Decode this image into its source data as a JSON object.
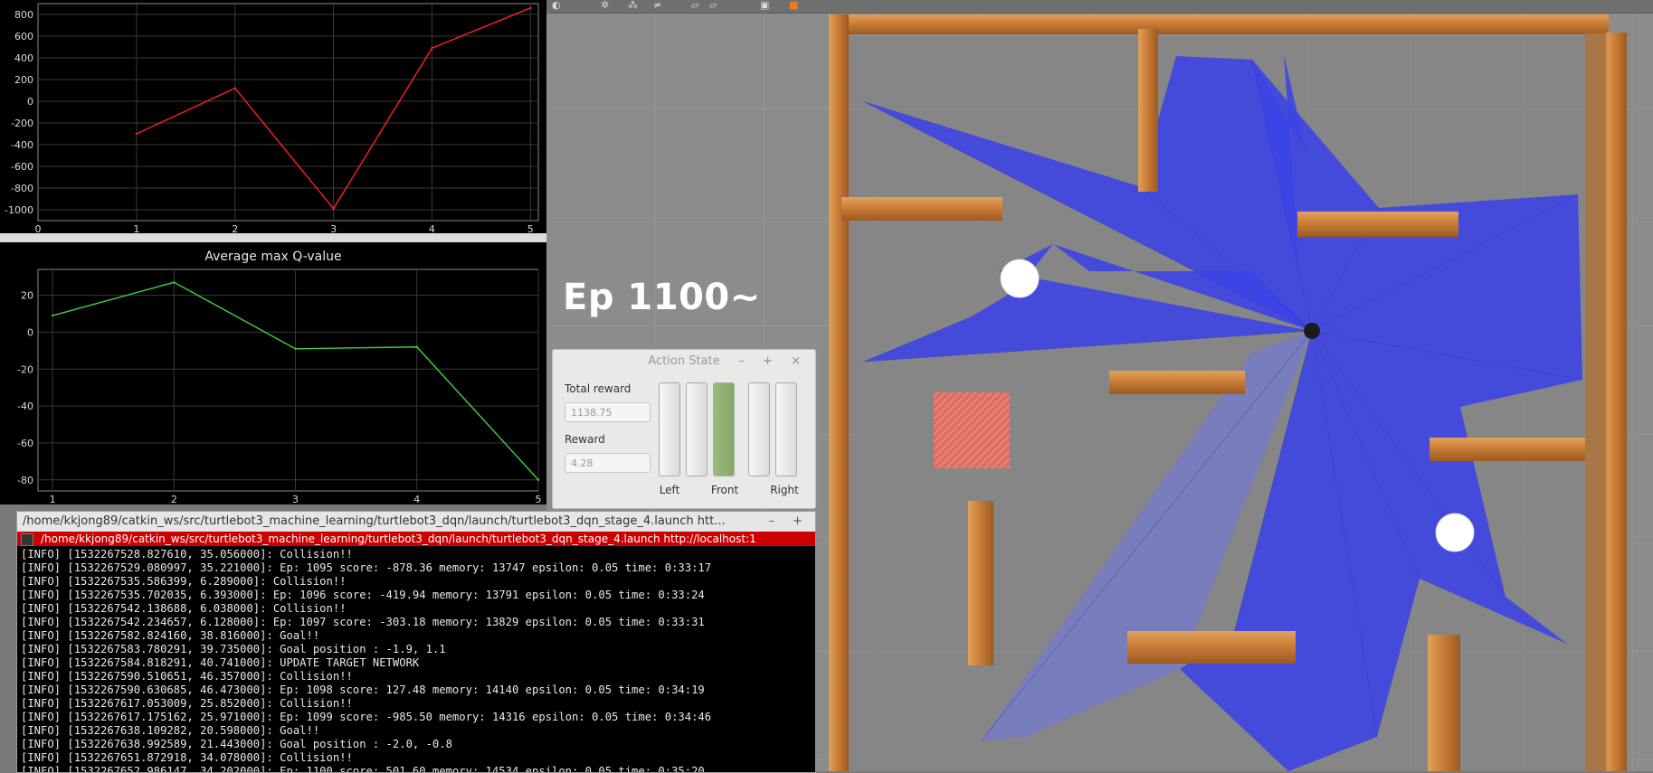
{
  "overlay": {
    "episode_label": "Ep 1100~"
  },
  "plot_score": {
    "chart_data": {
      "type": "line",
      "title": "",
      "x": [
        1,
        2,
        3,
        4,
        5
      ],
      "series": [
        {
          "values": [
            -300,
            120,
            -990,
            490,
            860
          ],
          "color": "#ff2020"
        }
      ],
      "y_ticks": [
        "800",
        "600",
        "400",
        "200",
        "0",
        "-200",
        "-400",
        "-600",
        "-800",
        "-1000"
      ],
      "x_ticks": [
        "0",
        "1",
        "2",
        "3",
        "4",
        "5"
      ],
      "ylim": [
        -1100,
        900
      ],
      "grid": true
    }
  },
  "plot_q": {
    "title": "Average max Q-value",
    "chart_data": {
      "type": "line",
      "title": "Average max Q-value",
      "x": [
        1,
        2,
        3,
        4,
        5
      ],
      "series": [
        {
          "values": [
            9,
            27,
            -9,
            -8,
            -80
          ],
          "color": "#40d040"
        }
      ],
      "y_ticks": [
        "20",
        "0",
        "-20",
        "-40",
        "-60",
        "-80"
      ],
      "x_ticks": [
        "1",
        "2",
        "3",
        "4",
        "5"
      ],
      "ylim": [
        -86,
        34
      ],
      "grid": true
    }
  },
  "action_state": {
    "title": "Action State",
    "window_buttons": "– + ×",
    "total_reward_label": "Total reward",
    "total_reward_value": "1138.75",
    "reward_label": "Reward",
    "reward_value": "4.28",
    "bars": [
      {
        "name": "action-bar-1",
        "level": 0
      },
      {
        "name": "action-bar-2",
        "level": 0
      },
      {
        "name": "action-bar-3",
        "level": 1
      },
      {
        "name": "action-bar-4",
        "level": 0
      },
      {
        "name": "action-bar-5",
        "level": 0
      }
    ],
    "labels": {
      "left": "Left",
      "front": "Front",
      "right": "Right"
    }
  },
  "terminal": {
    "title": "/home/kkjong89/catkin_ws/src/turtlebot3_machine_learning/turtlebot3_dqn/launch/turtlebot3_dqn_stage_4.launch htt...",
    "window_buttons": "– + ×",
    "tab": "/home/kkjong89/catkin_ws/src/turtlebot3_machine_learning/turtlebot3_dqn/launch/turtlebot3_dqn_stage_4.launch http://localhost:1",
    "lines": [
      "[INFO] [1532267528.827610, 35.056000]: Collision!!",
      "[INFO] [1532267529.080997, 35.221000]: Ep: 1095 score: -878.36 memory: 13747 epsilon: 0.05 time: 0:33:17",
      "[INFO] [1532267535.586399, 6.289000]: Collision!!",
      "[INFO] [1532267535.702035, 6.393000]: Ep: 1096 score: -419.94 memory: 13791 epsilon: 0.05 time: 0:33:24",
      "[INFO] [1532267542.138688, 6.038000]: Collision!!",
      "[INFO] [1532267542.234657, 6.128000]: Ep: 1097 score: -303.18 memory: 13829 epsilon: 0.05 time: 0:33:31",
      "[INFO] [1532267582.824160, 38.816000]: Goal!!",
      "[INFO] [1532267583.780291, 39.735000]: Goal position : -1.9, 1.1",
      "[INFO] [1532267584.818291, 40.741000]: UPDATE TARGET NETWORK",
      "[INFO] [1532267590.510651, 46.357000]: Collision!!",
      "[INFO] [1532267590.630685, 46.473000]: Ep: 1098 score: 127.48 memory: 14140 epsilon: 0.05 time: 0:34:19",
      "[INFO] [1532267617.053009, 25.852000]: Collision!!",
      "[INFO] [1532267617.175162, 25.971000]: Ep: 1099 score: -985.50 memory: 14316 epsilon: 0.05 time: 0:34:46",
      "[INFO] [1532267638.109282, 20.598000]: Goal!!",
      "[INFO] [1532267638.992589, 21.443000]: Goal position : -2.0, -0.8",
      "[INFO] [1532267651.872918, 34.078000]: Collision!!",
      "[INFO] [1532267652.986147, 34.202000]: Ep: 1100 score: 501.60 memory: 14534 epsilon: 0.05 time: 0:35:20"
    ]
  }
}
